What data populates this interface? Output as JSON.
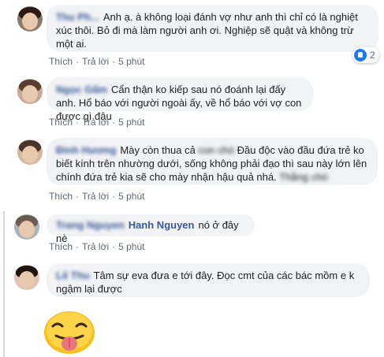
{
  "comments": [
    {
      "name": "Thu Ph...",
      "text": "Anh ạ. à không loại đánh vợ như anh thì chỉ có là nghiệt xúc thôi. Bỏ đi mà làm người anh ơi. Nghiệp sẽ quật và không trừ một ai.",
      "like": "Thích",
      "reply": "Trả lời",
      "time": "5 phút",
      "reactions": "2"
    },
    {
      "name": "Ngọc Gấm",
      "text": "Cẩn thận ko kiếp sau nó đoánh lại đấy anh. Hổ báo với người ngoài ấy, về hổ báo với vợ con được gì đâu",
      "like": "Thích",
      "reply": "Trả lời",
      "time": "5 phút"
    },
    {
      "name": "Đinh Hương",
      "text_a": "Mày còn thua cả ",
      "hidden_word": "con chó",
      "text_b": " Đầu độc vào đầu đứa trẻ ko biết kính trên nhường dưới, sống không phải đạo thì sau này lớn lên chính đứa trẻ kia sẽ cho mày nhận hậu quả nhá.",
      "trailing_hidden": "Thằng chó",
      "like": "Thích",
      "reply": "Trả lời",
      "time": "5 phút"
    },
    {
      "name_hidden": "Trang Nguyen",
      "name_visible": "Hanh Nguyen",
      "text": "nó ở đây nè",
      "like": "Thích",
      "reply": "Trả lời",
      "time": "5 phút"
    },
    {
      "name": "Lê Thu",
      "text": "Tâm sự eva đưa e tới đây. Đọc cmt của các bác mồm e k ngậm lại được"
    }
  ]
}
